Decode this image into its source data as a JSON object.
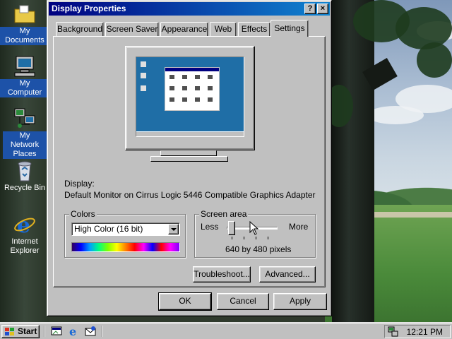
{
  "desktop": {
    "icons": [
      {
        "label": "My Documents"
      },
      {
        "label": "My Computer"
      },
      {
        "label": "My Network Places"
      },
      {
        "label": "Recycle Bin"
      },
      {
        "label": "Internet Explorer"
      }
    ]
  },
  "dialog": {
    "title": "Display Properties",
    "help_button": "?",
    "close_button": "×",
    "tabs": [
      {
        "label": "Background"
      },
      {
        "label": "Screen Saver"
      },
      {
        "label": "Appearance"
      },
      {
        "label": "Web"
      },
      {
        "label": "Effects"
      },
      {
        "label": "Settings",
        "active": true
      }
    ],
    "display_label": "Display:",
    "display_value": "Default Monitor on Cirrus Logic 5446 Compatible Graphics Adapter",
    "colors": {
      "group_label": "Colors",
      "selected": "High Color (16 bit)"
    },
    "screen_area": {
      "group_label": "Screen area",
      "less_label": "Less",
      "more_label": "More",
      "value_text": "640 by 480 pixels",
      "slider_fraction": 0.0
    },
    "troubleshoot_button": "Troubleshoot...",
    "advanced_button": "Advanced...",
    "ok_button": "OK",
    "cancel_button": "Cancel",
    "apply_button": "Apply"
  },
  "taskbar": {
    "start_label": "Start",
    "clock": "12:21 PM",
    "quick_launch": [
      "show-desktop-icon",
      "internet-explorer-icon",
      "outlook-express-icon"
    ]
  },
  "colors": {
    "titlebar_start": "#000080",
    "titlebar_end": "#1084d0",
    "face": "#c0c0c0",
    "selection": "#1d52a8"
  }
}
